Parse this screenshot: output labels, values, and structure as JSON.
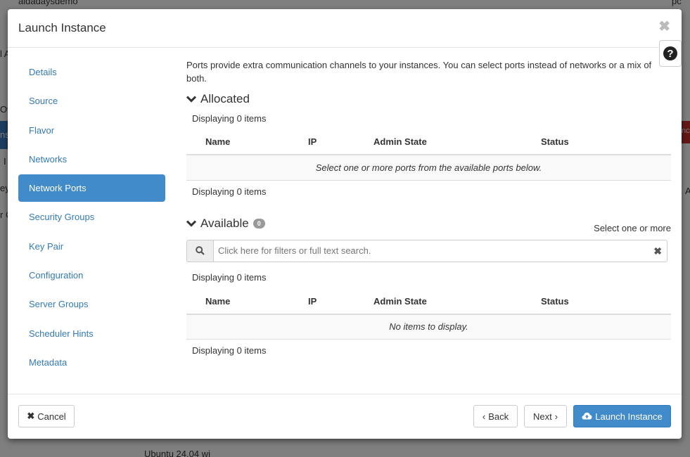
{
  "background": {
    "frags": [
      "aldadaysdemo",
      "pc",
      "l A",
      "Ov",
      "ns",
      "I",
      "ey",
      "r C",
      "Ubuntu 24.04 wi",
      "nce",
      "A"
    ]
  },
  "modal": {
    "title": "Launch Instance",
    "close_glyph": "✖",
    "help_glyph": "?"
  },
  "nav": {
    "items": [
      {
        "label": "Details"
      },
      {
        "label": "Source"
      },
      {
        "label": "Flavor"
      },
      {
        "label": "Networks"
      },
      {
        "label": "Network Ports",
        "active": true
      },
      {
        "label": "Security Groups"
      },
      {
        "label": "Key Pair"
      },
      {
        "label": "Configuration"
      },
      {
        "label": "Server Groups"
      },
      {
        "label": "Scheduler Hints"
      },
      {
        "label": "Metadata"
      }
    ]
  },
  "content": {
    "intro": "Ports provide extra communication channels to your instances. You can select ports instead of networks or a mix of both.",
    "allocated": {
      "title": "Allocated",
      "displaying_top": "Displaying 0 items",
      "columns": [
        "Name",
        "IP",
        "Admin State",
        "Status"
      ],
      "empty_message": "Select one or more ports from the available ports below.",
      "displaying_bottom": "Displaying 0 items"
    },
    "available": {
      "title": "Available",
      "count": "0",
      "select_note": "Select one or more",
      "search_placeholder": "Click here for filters or full text search.",
      "displaying_top": "Displaying 0 items",
      "columns": [
        "Name",
        "IP",
        "Admin State",
        "Status"
      ],
      "empty_message": "No items to display.",
      "displaying_bottom": "Displaying 0 items"
    }
  },
  "footer": {
    "cancel_label": "Cancel",
    "back_label": "Back",
    "next_label": "Next",
    "launch_label": "Launch Instance"
  },
  "colors": {
    "primary": "#428bca",
    "link": "#337ab7"
  }
}
